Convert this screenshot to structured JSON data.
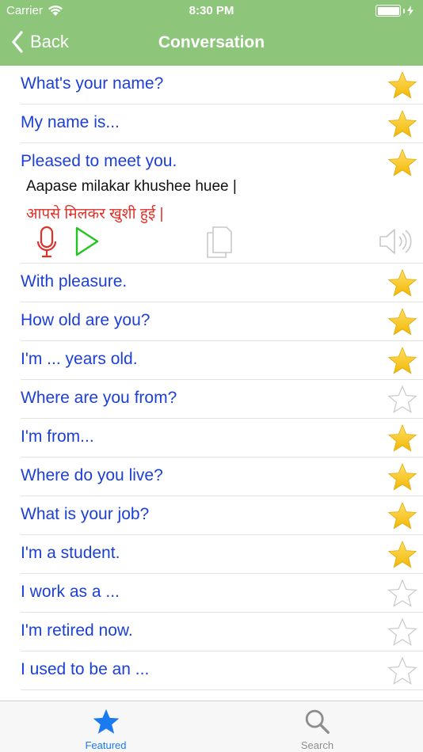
{
  "status_bar": {
    "carrier": "Carrier",
    "time": "8:30 PM"
  },
  "nav": {
    "back_label": "Back",
    "title": "Conversation"
  },
  "colors": {
    "accent_green": "#8dc67a",
    "phrase_blue": "#1c3fd8",
    "hindi_red": "#e0302a",
    "tab_active": "#1a7af0"
  },
  "phrases": [
    {
      "text": "What's your name?",
      "favorited": true
    },
    {
      "text": "My name is...",
      "favorited": true
    },
    {
      "text": "Pleased to meet you.",
      "favorited": true,
      "expanded": true,
      "transliteration": "Aapase milakar khushee huee |",
      "hindi": "आपसे मिलकर खुशी हुई |"
    },
    {
      "text": "With pleasure.",
      "favorited": true
    },
    {
      "text": "How old are you?",
      "favorited": true
    },
    {
      "text": "I'm ... years old.",
      "favorited": true
    },
    {
      "text": "Where are you from?",
      "favorited": false
    },
    {
      "text": "I'm from...",
      "favorited": true
    },
    {
      "text": "Where do you live?",
      "favorited": true
    },
    {
      "text": "What is your job?",
      "favorited": true
    },
    {
      "text": "I'm a student.",
      "favorited": true
    },
    {
      "text": "I work as a ...",
      "favorited": false
    },
    {
      "text": "I'm retired now.",
      "favorited": false
    },
    {
      "text": "I used to be an ...",
      "favorited": false
    }
  ],
  "tabs": {
    "featured_label": "Featured",
    "search_label": "Search"
  }
}
